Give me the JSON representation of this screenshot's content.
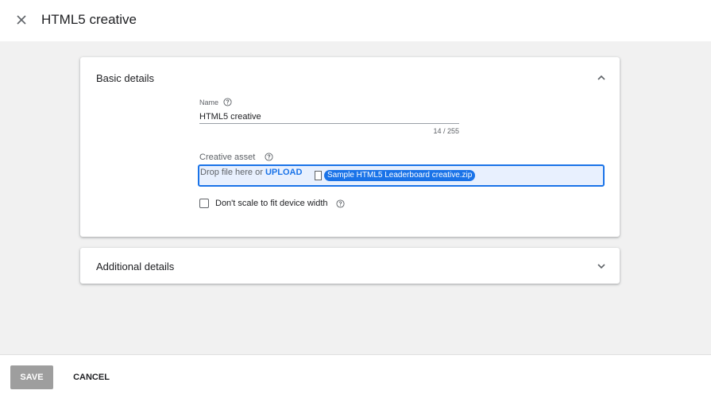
{
  "header": {
    "title": "HTML5 creative",
    "close_icon": "close-icon"
  },
  "basic_details": {
    "title": "Basic details",
    "toggle_icon": "chevron-up-icon",
    "name": {
      "label": "Name",
      "value": "HTML5 creative",
      "char_count": "14 / 255"
    },
    "creative_asset": {
      "label": "Creative asset",
      "drop_text": "Drop file here or ",
      "upload_label": "UPLOAD",
      "file_name": "Sample HTML5 Leaderboard creative.zip"
    },
    "scale_checkbox": {
      "label": "Don't scale to fit device width",
      "checked": false
    }
  },
  "additional_details": {
    "title": "Additional details",
    "toggle_icon": "chevron-down-icon"
  },
  "footer": {
    "save_label": "SAVE",
    "cancel_label": "CANCEL"
  },
  "colors": {
    "accent": "#1a73e8",
    "background": "#f1f1f1",
    "save_disabled": "#9e9e9e"
  }
}
